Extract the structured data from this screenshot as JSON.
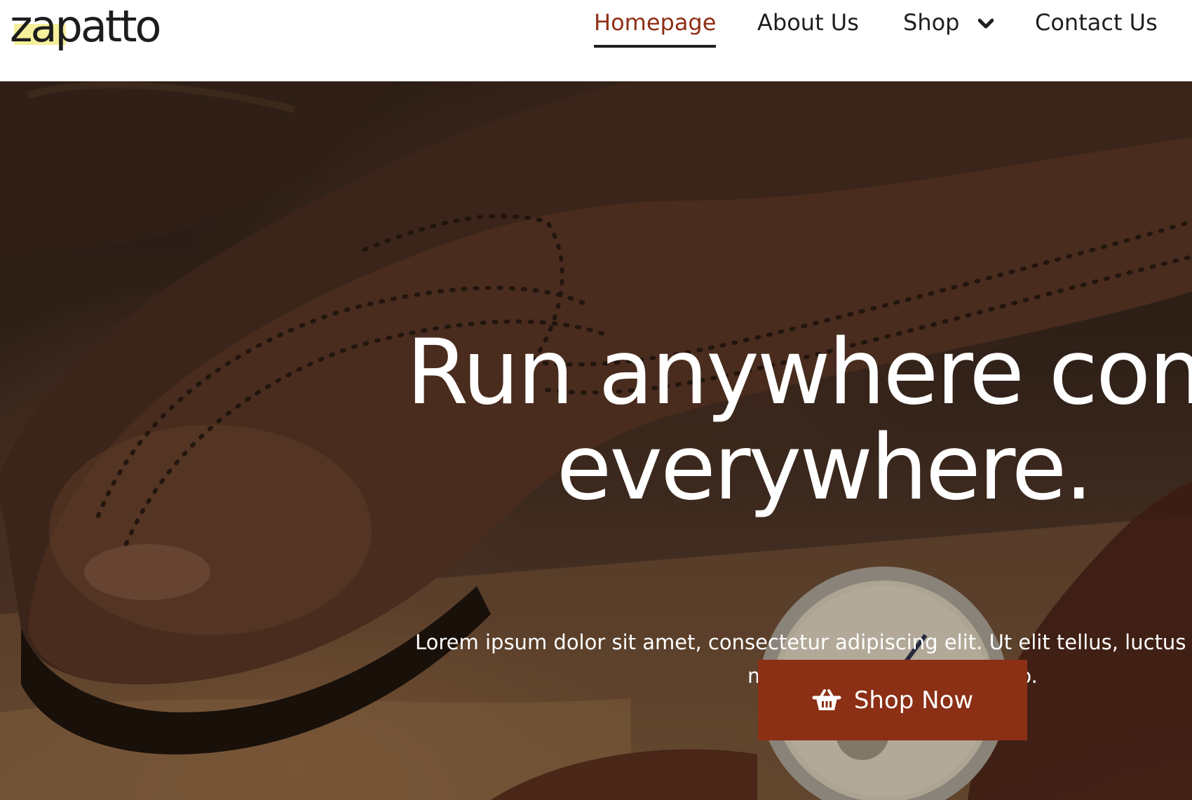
{
  "brand": {
    "logo_text": "zapatto",
    "accent_color": "#8b2f15",
    "logo_highlight_color": "#f6ef9b"
  },
  "nav": {
    "items": [
      {
        "label": "Homepage",
        "active": true
      },
      {
        "label": "About Us",
        "active": false
      },
      {
        "label": "Shop",
        "active": false,
        "has_dropdown": true
      },
      {
        "label": "Contact Us",
        "active": false
      }
    ],
    "dropdown_icon": "chevron-down-icon"
  },
  "hero": {
    "headline_line1": "Run anywhere com",
    "headline_line2": "everywhere.",
    "subtext_line1": "Lorem ipsum dolor sit amet, consectetur adipiscing elit. Ut elit tellus, luctus",
    "subtext_line2": "mattis, pulvinar dapibus leo.",
    "cta_label": "Shop Now",
    "cta_icon": "shopping-basket-icon",
    "background_image": "brogue-shoe-and-watch-photo"
  }
}
